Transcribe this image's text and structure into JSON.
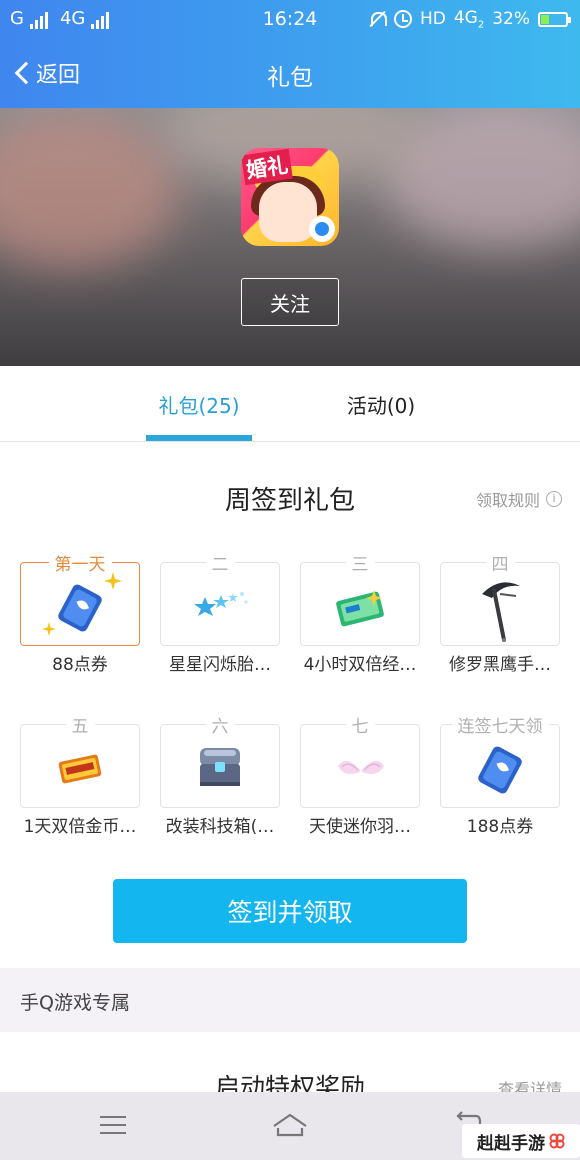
{
  "status_bar": {
    "carrier": "G",
    "network": "4G",
    "time": "16:24",
    "hd_label": "HD",
    "network_right": "4G",
    "network_right_sub": "2",
    "battery": "32%",
    "battery_level": 0.32
  },
  "nav": {
    "back_label": "返回",
    "title": "礼包"
  },
  "app": {
    "icon_badge": "婚礼",
    "follow_label": "关注"
  },
  "tabs": [
    {
      "label": "礼包(25)",
      "active": true
    },
    {
      "label": "活动(0)",
      "active": false
    }
  ],
  "weekly": {
    "title": "周签到礼包",
    "rules_label": "领取规则",
    "info_icon_glyph": "i",
    "days": [
      {
        "day_label": "第一天",
        "item": "88点券",
        "icon": "coupon-card-icon"
      },
      {
        "day_label": "二",
        "item": "星星闪烁胎…",
        "icon": "star-trail-icon"
      },
      {
        "day_label": "三",
        "item": "4小时双倍经…",
        "icon": "double-exp-card-icon"
      },
      {
        "day_label": "四",
        "item": "修罗黑鹰手…",
        "icon": "black-hawk-scythe-icon"
      },
      {
        "day_label": "五",
        "item": "1天双倍金币…",
        "icon": "double-coin-card-icon"
      },
      {
        "day_label": "六",
        "item": "改装科技箱(…",
        "icon": "tech-chest-icon"
      },
      {
        "day_label": "七",
        "item": "天使迷你羽…",
        "icon": "angel-wings-icon"
      },
      {
        "day_label": "连签七天领",
        "item": "188点券",
        "icon": "coupon-card-icon"
      }
    ],
    "cta_label": "签到并领取"
  },
  "exclusive": {
    "section_label": "手Q游戏专属",
    "title": "启动特权奖励",
    "details_label": "查看详情"
  },
  "watermark": {
    "text": "赳赳手游"
  },
  "colors": {
    "header_start": "#3f86ef",
    "header_end": "#3eb9ee",
    "tab_active": "#2a9fd8",
    "cta": "#14b6ef",
    "first_day_border": "#e98a47"
  }
}
